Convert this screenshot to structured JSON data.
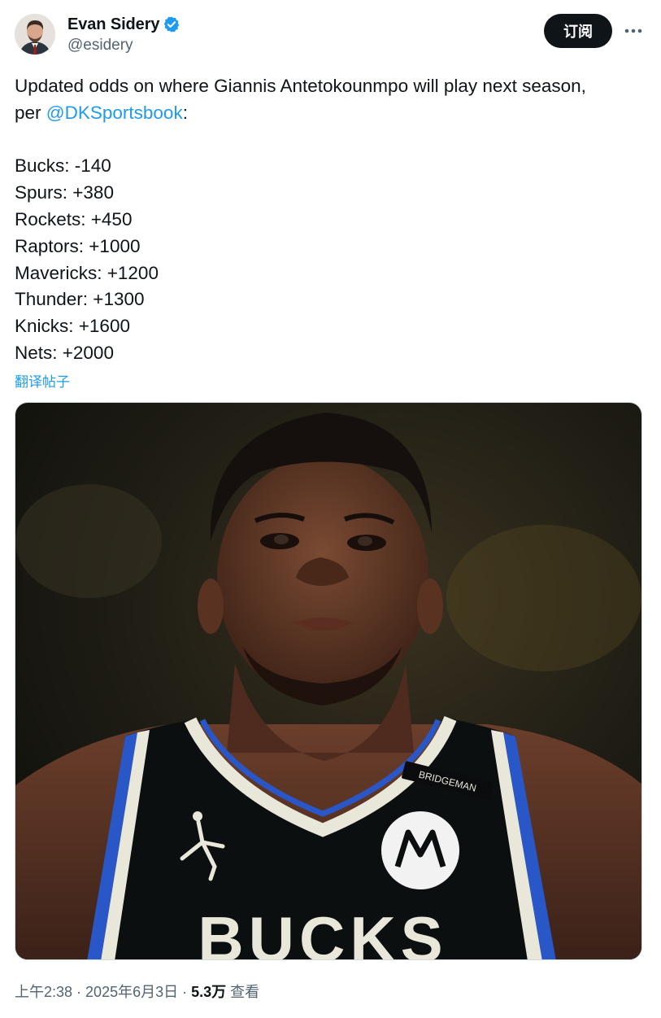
{
  "author": {
    "name": "Evan Sidery",
    "handle": "@esidery",
    "verified_color": "#1d9bf0"
  },
  "actions": {
    "subscribe_label": "订阅",
    "more_icon": "more-horizontal-icon"
  },
  "tweet": {
    "intro_line1": "Updated odds on where Giannis Antetokounmpo will play next season,",
    "intro_prefix": "per ",
    "mention": "@DKSportsbook",
    "intro_suffix": ":",
    "odds": [
      "Bucks: -140",
      "Spurs: +380",
      "Rockets: +450",
      "Raptors: +1000",
      "Mavericks: +1200",
      "Thunder: +1300",
      "Knicks: +1600",
      "Nets: +2000"
    ],
    "translate_label": "翻译帖子"
  },
  "media": {
    "jersey_patch": "BRIDGEMAN",
    "jersey_letters": "BUCKS"
  },
  "meta": {
    "time": "上午2:38",
    "sep1": " · ",
    "date": "2025年6月3日",
    "sep2": " · ",
    "views_count": "5.3万",
    "views_label": " 查看"
  },
  "colors": {
    "accent": "#1d9bf0",
    "text": "#0f1419",
    "secondary": "#536471"
  }
}
